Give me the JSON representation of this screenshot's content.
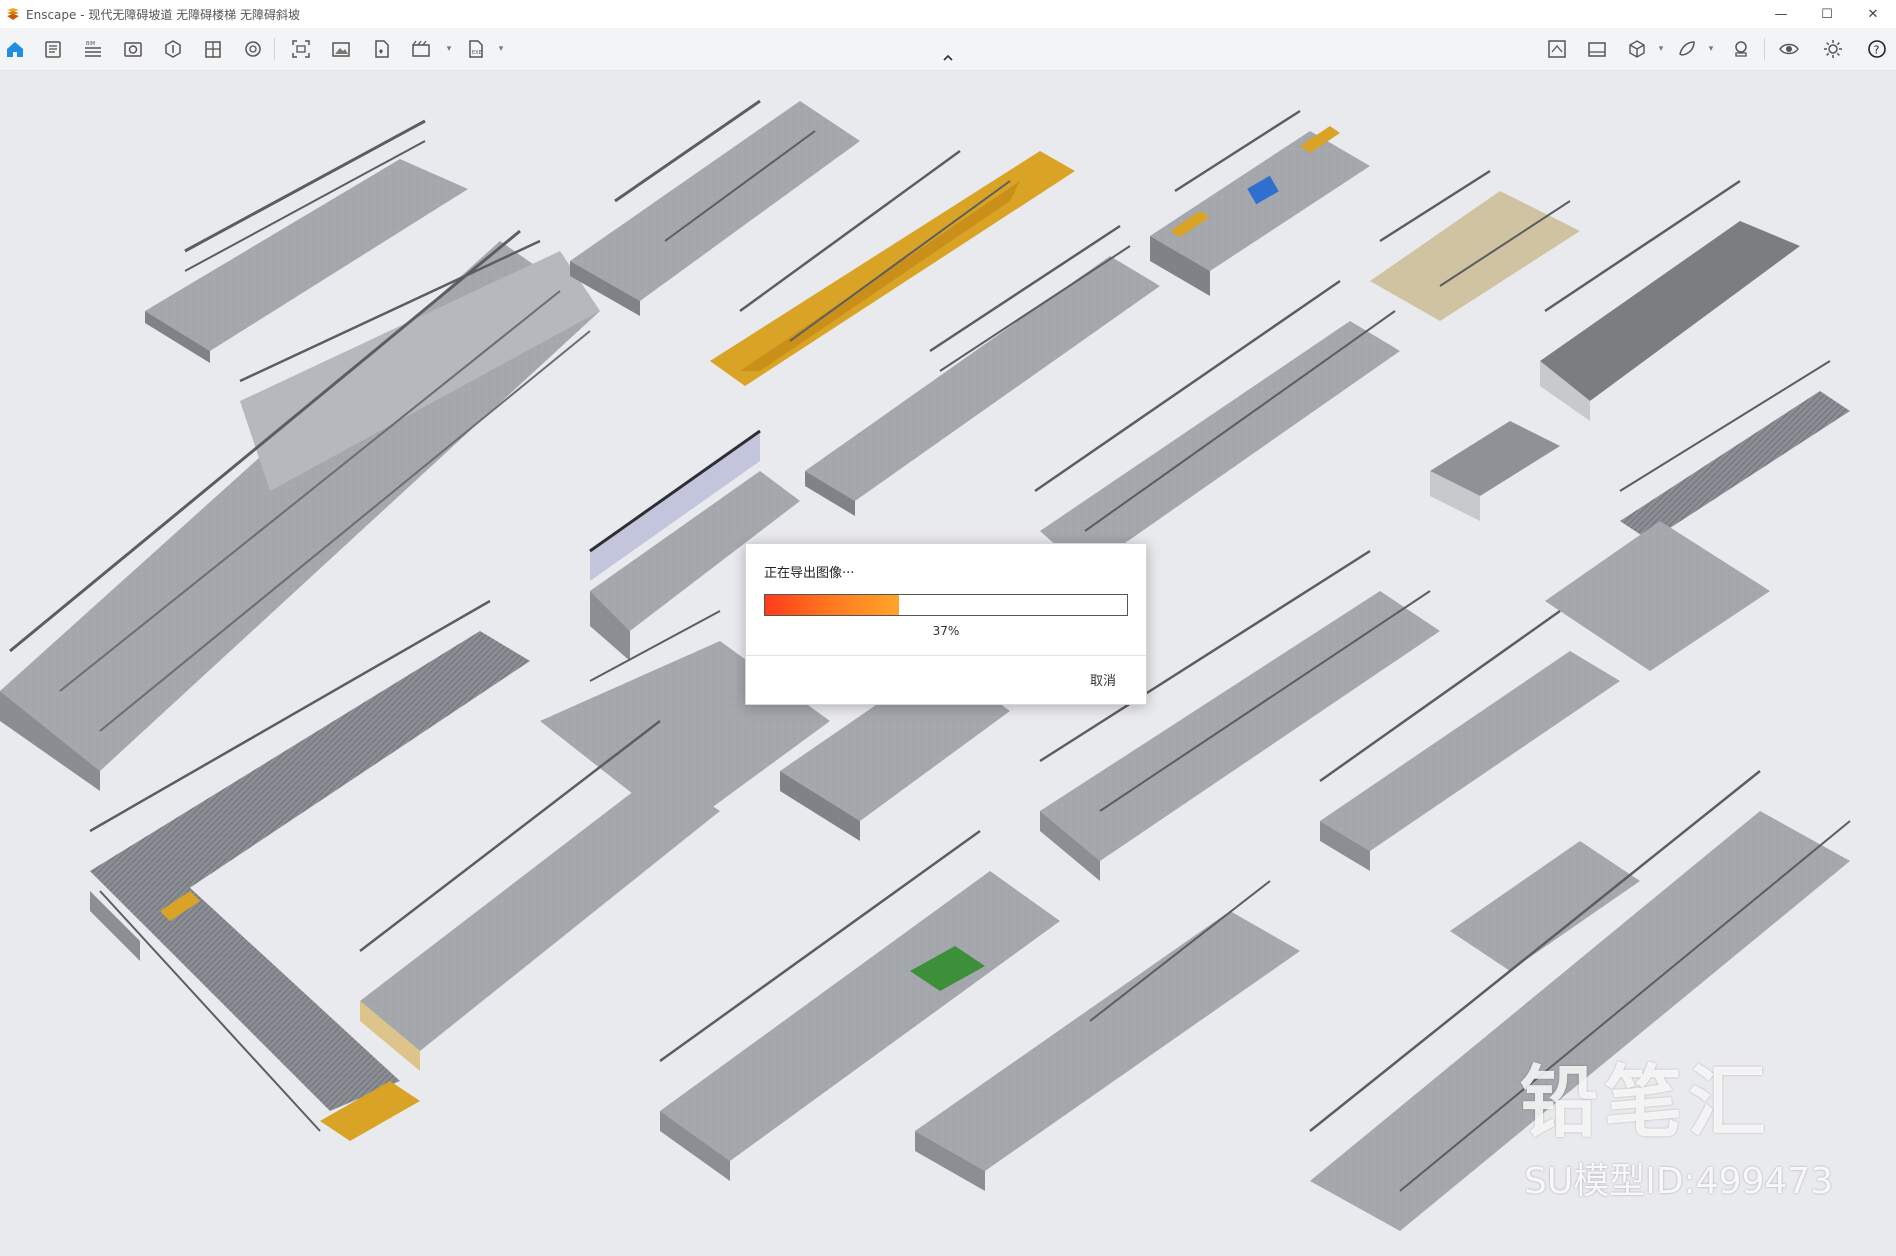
{
  "window": {
    "app_name": "Enscape",
    "title": "Enscape - 现代无障碍坡道 无障碍楼梯 无障碍斜坡",
    "controls": [
      "—",
      "☐",
      "✕"
    ]
  },
  "toolbar": {
    "left_icons": [
      "home-icon",
      "views-icon",
      "bim-icon",
      "visual-settings-icon",
      "asset-library-icon",
      "material-editor-icon",
      "atmosphere-icon",
      "capture-icon",
      "screenshot-icon",
      "batch-render-icon",
      "video-editor-icon",
      "export-icon"
    ],
    "right_icons": [
      "collaborate-icon",
      "gallery-icon",
      "cube-icon",
      "feedback-icon",
      "vr-headset-icon",
      "eye-icon",
      "settings-icon",
      "help-icon"
    ]
  },
  "dialog": {
    "title": "正在导出图像···",
    "progress": 0.37,
    "progress_label": "37%",
    "cancel_label": "取消"
  },
  "watermark": {
    "brand": "铅笔汇",
    "model_id": "SU模型ID:499473"
  },
  "colors": {
    "accent_home": "#1e8fe0",
    "progress_start": "#ff3b1a",
    "progress_end": "#ffa42a",
    "tactile_yellow": "#d9a326",
    "concrete": "#9fa2a7"
  }
}
